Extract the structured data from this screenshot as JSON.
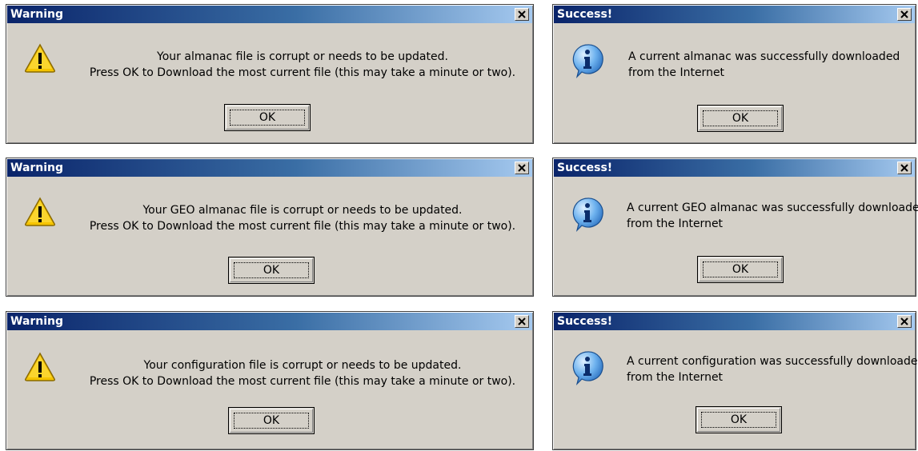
{
  "dialogs": [
    {
      "title": "Warning",
      "type": "warning",
      "lines": [
        "Your almanac file is corrupt or needs to be updated.",
        "Press OK to Download the most current file (this may take a minute or two)."
      ],
      "button": "OK"
    },
    {
      "title": "Success!",
      "type": "info",
      "lines": [
        "A current almanac was successfully downloaded",
        "from the Internet"
      ],
      "button": "OK"
    },
    {
      "title": "Warning",
      "type": "warning",
      "lines": [
        "Your GEO almanac file is corrupt or needs to be updated.",
        "Press OK to Download the most current file (this may take a minute or two)."
      ],
      "button": "OK"
    },
    {
      "title": "Success!",
      "type": "info",
      "lines": [
        "A current GEO almanac was successfully downloaded",
        "from the Internet"
      ],
      "button": "OK"
    },
    {
      "title": "Warning",
      "type": "warning",
      "lines": [
        "Your configuration file is corrupt or needs to be updated.",
        "Press OK to Download the most current file (this may take a minute or two)."
      ],
      "button": "OK"
    },
    {
      "title": "Success!",
      "type": "info",
      "lines": [
        "A current configuration was successfully downloaded",
        "from the Internet"
      ],
      "button": "OK"
    }
  ],
  "icons": {
    "warning": "warning-icon",
    "info": "info-icon",
    "close": "close-icon"
  },
  "colors": {
    "dialog_face": "#d4d0c8",
    "title_start": "#0a246a",
    "title_end": "#a6caf0",
    "warning_yellow": "#f5c400",
    "info_blue": "#2e7fd6"
  }
}
